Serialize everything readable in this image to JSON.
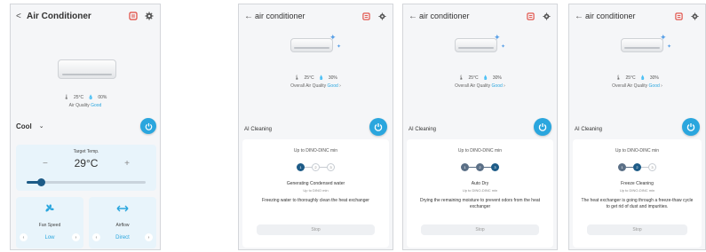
{
  "screen1": {
    "title": "Air Conditioner",
    "back": "<",
    "temp": "25°C",
    "humidity": "00%",
    "air_quality": "Air Quality",
    "air_quality_value": "Good",
    "mode": "Cool",
    "mode_arrow": "⌄",
    "target_label": "Target Temp.",
    "target_value": "29°C",
    "minus": "−",
    "plus": "+",
    "slider_level": 0.12,
    "fan_label": "Fan Speed",
    "fan_value": "Low",
    "airflow_label": "Airflow",
    "airflow_value": "Direct"
  },
  "clean_screens": [
    {
      "title": "air conditioner",
      "temp": "25°C",
      "humidity": "30%",
      "air_quality": "Overall Air Quality",
      "air_quality_value": "Good",
      "section": "AI Cleaning",
      "upto": "Up to DINO-DINC min",
      "steps": [
        "1",
        "2",
        "3"
      ],
      "active_step": 0,
      "step_name": "Generating Condensed water",
      "step_sub": "Up to DINO min",
      "description": "Freezing water to thoroughly clean the heat exchanger",
      "stop": "Stop"
    },
    {
      "title": "air conditioner",
      "temp": "25°C",
      "humidity": "30%",
      "air_quality": "Overall Air Quality",
      "air_quality_value": "Good",
      "section": "AI Cleaning",
      "upto": "Up to DINO-DINC min",
      "steps": [
        "1",
        "2",
        "3"
      ],
      "active_step": 2,
      "step_name": "Auto Dry",
      "step_sub": "Up to DINO-DINC min",
      "description": "Drying the remaining moisture to prevent odors from the heat exchanger",
      "stop": "Stop"
    },
    {
      "title": "air conditioner",
      "temp": "25°C",
      "humidity": "30%",
      "air_quality": "Overall Air Quality",
      "air_quality_value": "Good",
      "section": "AI Cleaning",
      "upto": "Up to DINO-DINC min",
      "steps": [
        "1",
        "2",
        "3"
      ],
      "active_step": 1,
      "step_name": "Freeze Cleaning",
      "step_sub": "Up to DINO-DINC min",
      "description": "The heat exchanger is going through a freeze-thaw cycle to get rid of dust and impurities.",
      "stop": "Stop"
    }
  ],
  "colors": {
    "accent": "#2aa6de",
    "menu_red": "#e0463c",
    "step_active": "#1d5b87"
  },
  "icons": [
    "back-arrow-icon",
    "menu-icon",
    "gear-icon",
    "power-icon",
    "fan-icon",
    "airflow-icon",
    "thermometer-icon",
    "droplet-icon",
    "sparkle-icon"
  ]
}
